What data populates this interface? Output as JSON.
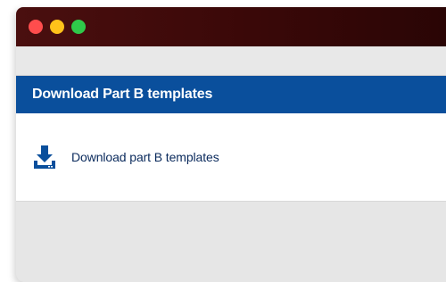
{
  "window": {
    "controls": {
      "close_color": "#ff4d4d",
      "minimize_color": "#ffc21a",
      "maximize_color": "#2fc94a"
    }
  },
  "panel": {
    "title": "Download Part B templates",
    "header_color": "#0a4f9c",
    "link": {
      "icon": "download-icon",
      "label": "Download part B templates"
    }
  }
}
